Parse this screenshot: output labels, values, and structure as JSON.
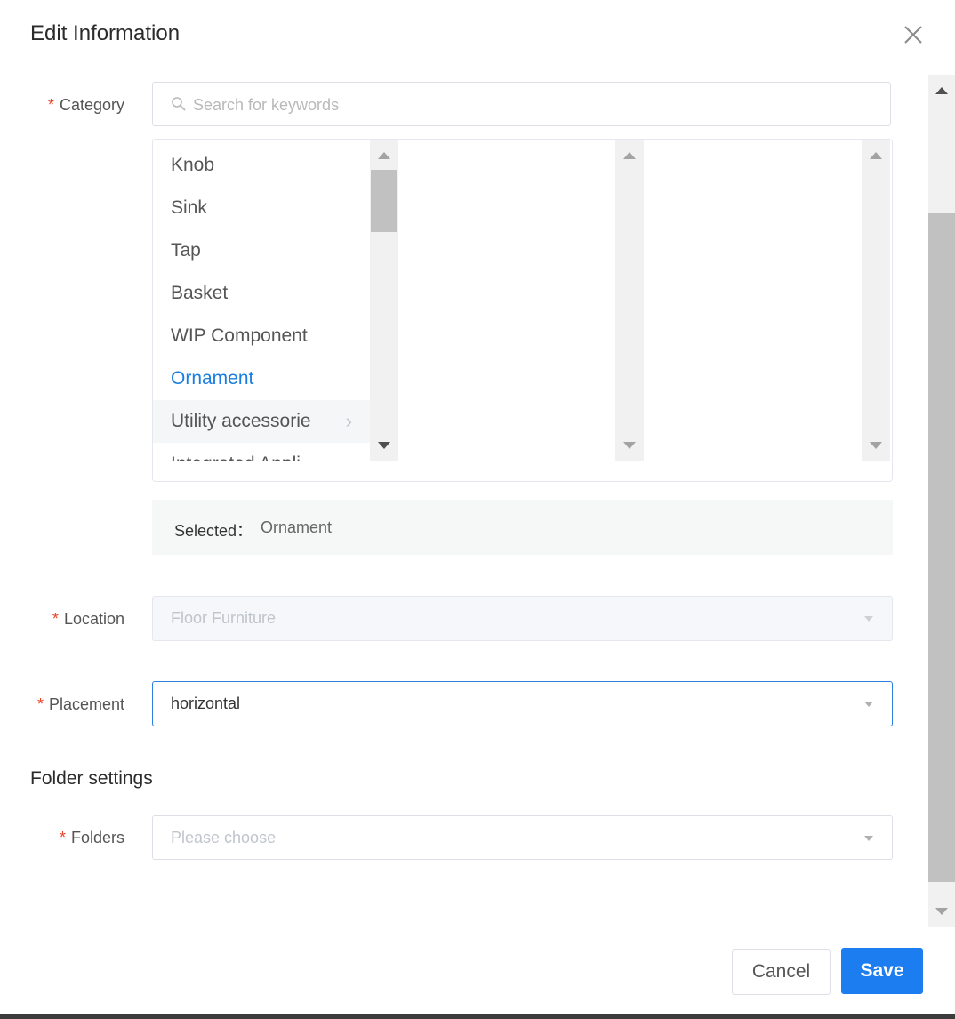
{
  "dialog": {
    "title": "Edit Information",
    "close_icon": "close-icon"
  },
  "category": {
    "label": "Category",
    "required_mark": "*",
    "search_placeholder": "Search for keywords",
    "search_icon": "search-icon",
    "items": [
      {
        "label": "Knob",
        "has_children": false
      },
      {
        "label": "Sink",
        "has_children": false
      },
      {
        "label": "Tap",
        "has_children": false
      },
      {
        "label": "Basket",
        "has_children": false
      },
      {
        "label": "WIP Component",
        "has_children": false
      },
      {
        "label": "Ornament",
        "has_children": false,
        "active": true
      },
      {
        "label": "Utility accessorie",
        "has_children": true,
        "hover": true
      },
      {
        "label": "Integrated Appli",
        "has_children": true
      }
    ],
    "selected_label": "Selected：",
    "selected_value": "Ornament"
  },
  "location": {
    "label": "Location",
    "required_mark": "*",
    "value": "Floor Furniture",
    "disabled": true
  },
  "placement": {
    "label": "Placement",
    "required_mark": "*",
    "value": "horizontal"
  },
  "folder_settings": {
    "section_title": "Folder settings",
    "folders_label": "Folders",
    "required_mark": "*",
    "placeholder": "Please choose"
  },
  "footer": {
    "cancel_label": "Cancel",
    "save_label": "Save"
  },
  "colors": {
    "accent": "#1c7df0",
    "required": "#e8452c",
    "active_item": "#1a7ee0"
  }
}
